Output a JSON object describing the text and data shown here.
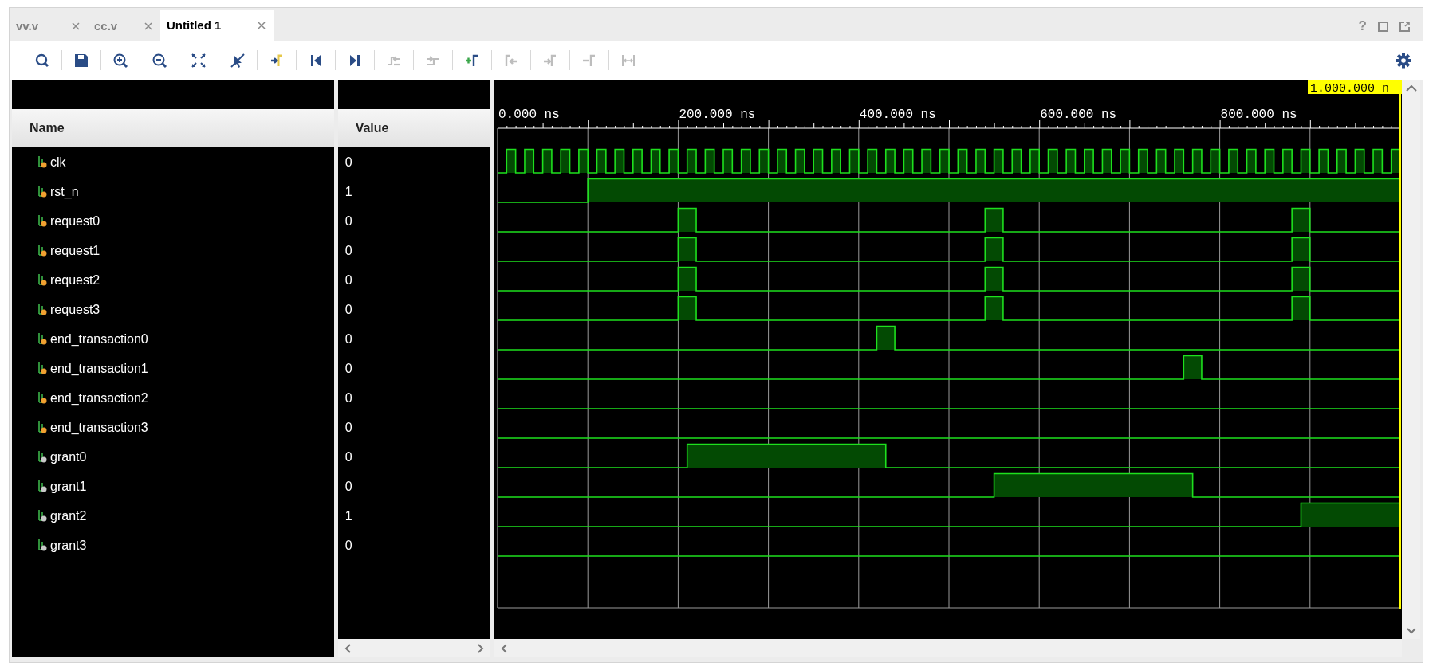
{
  "tabs": [
    {
      "label": "vv.v",
      "selected": false
    },
    {
      "label": "cc.v",
      "selected": false
    },
    {
      "label": "Untitled 1",
      "selected": true
    }
  ],
  "window_controls": {
    "help": "?"
  },
  "toolbar": [
    {
      "kind": "search",
      "disabled": false
    },
    {
      "kind": "save",
      "disabled": false
    },
    {
      "kind": "zoom-in",
      "disabled": false
    },
    {
      "kind": "zoom-out",
      "disabled": false
    },
    {
      "kind": "zoom-fit",
      "disabled": false
    },
    {
      "kind": "cursor-off",
      "disabled": false
    },
    {
      "kind": "goto-cursor",
      "disabled": false
    },
    {
      "kind": "goto-start",
      "disabled": false
    },
    {
      "kind": "goto-end",
      "disabled": false
    },
    {
      "kind": "prev-transition",
      "disabled": true
    },
    {
      "kind": "next-transition",
      "disabled": true
    },
    {
      "kind": "add-marker",
      "disabled": false
    },
    {
      "kind": "prev-marker",
      "disabled": true
    },
    {
      "kind": "next-marker",
      "disabled": true
    },
    {
      "kind": "swap-cursors",
      "disabled": true
    },
    {
      "kind": "distance",
      "disabled": true
    }
  ],
  "columns": [
    "Name",
    "Value"
  ],
  "signals": [
    {
      "name": "clk",
      "value": "0",
      "kind": "input"
    },
    {
      "name": "rst_n",
      "value": "1",
      "kind": "input"
    },
    {
      "name": "request0",
      "value": "0",
      "kind": "input"
    },
    {
      "name": "request1",
      "value": "0",
      "kind": "input"
    },
    {
      "name": "request2",
      "value": "0",
      "kind": "input"
    },
    {
      "name": "request3",
      "value": "0",
      "kind": "input"
    },
    {
      "name": "end_transaction0",
      "value": "0",
      "kind": "input"
    },
    {
      "name": "end_transaction1",
      "value": "0",
      "kind": "input"
    },
    {
      "name": "end_transaction2",
      "value": "0",
      "kind": "input"
    },
    {
      "name": "end_transaction3",
      "value": "0",
      "kind": "input"
    },
    {
      "name": "grant0",
      "value": "0",
      "kind": "output"
    },
    {
      "name": "grant1",
      "value": "0",
      "kind": "output"
    },
    {
      "name": "grant2",
      "value": "1",
      "kind": "output"
    },
    {
      "name": "grant3",
      "value": "0",
      "kind": "output"
    }
  ],
  "time_axis": {
    "labels": [
      "0.000 ns",
      "200.000 ns",
      "400.000 ns",
      "600.000 ns",
      "800.000 ns"
    ],
    "cursor_label": "1.000.000 n"
  }
}
